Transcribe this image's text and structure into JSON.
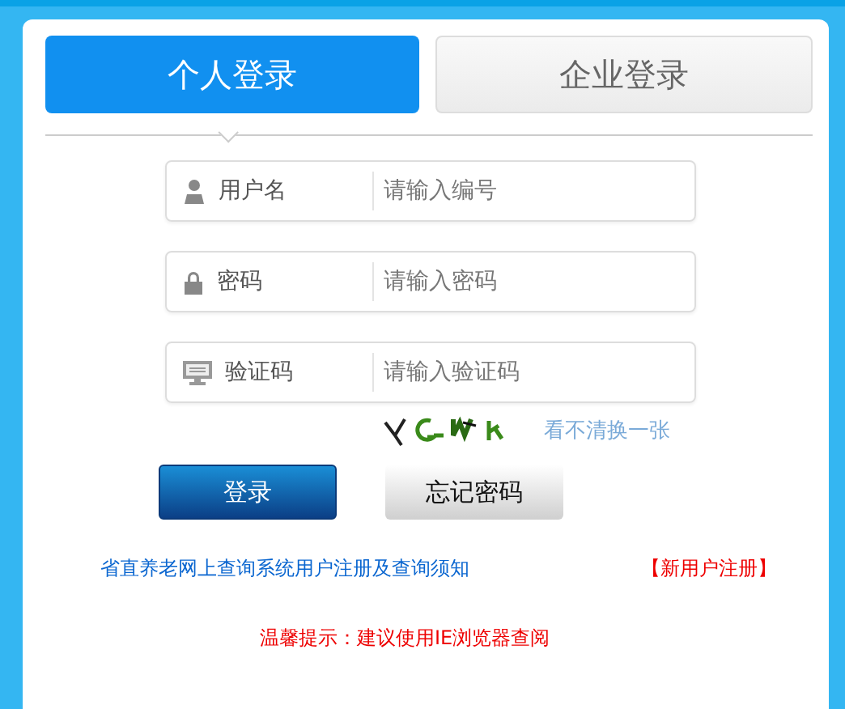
{
  "tabs": [
    {
      "label": "个人登录",
      "selected": true
    },
    {
      "label": "企业登录",
      "selected": false
    }
  ],
  "fields": [
    {
      "kind": "user",
      "label": "用户名",
      "placeholder": "请输入编号"
    },
    {
      "kind": "lock",
      "label": "密码",
      "placeholder": "请输入密码"
    },
    {
      "kind": "captcha",
      "label": "验证码",
      "placeholder": "请输入验证码"
    }
  ],
  "captcha": {
    "refresh_link": "看不清换一张"
  },
  "buttons": [
    {
      "kind": "primary",
      "label": "登录"
    },
    {
      "kind": "secondary",
      "label": "忘记密码"
    }
  ],
  "links": [
    {
      "kind": "notice",
      "text": "省直养老网上查询系统用户注册及查询须知"
    },
    {
      "kind": "register",
      "text": "【新用户注册】"
    }
  ],
  "tip": "温馨提示：建议使用IE浏览器查阅"
}
